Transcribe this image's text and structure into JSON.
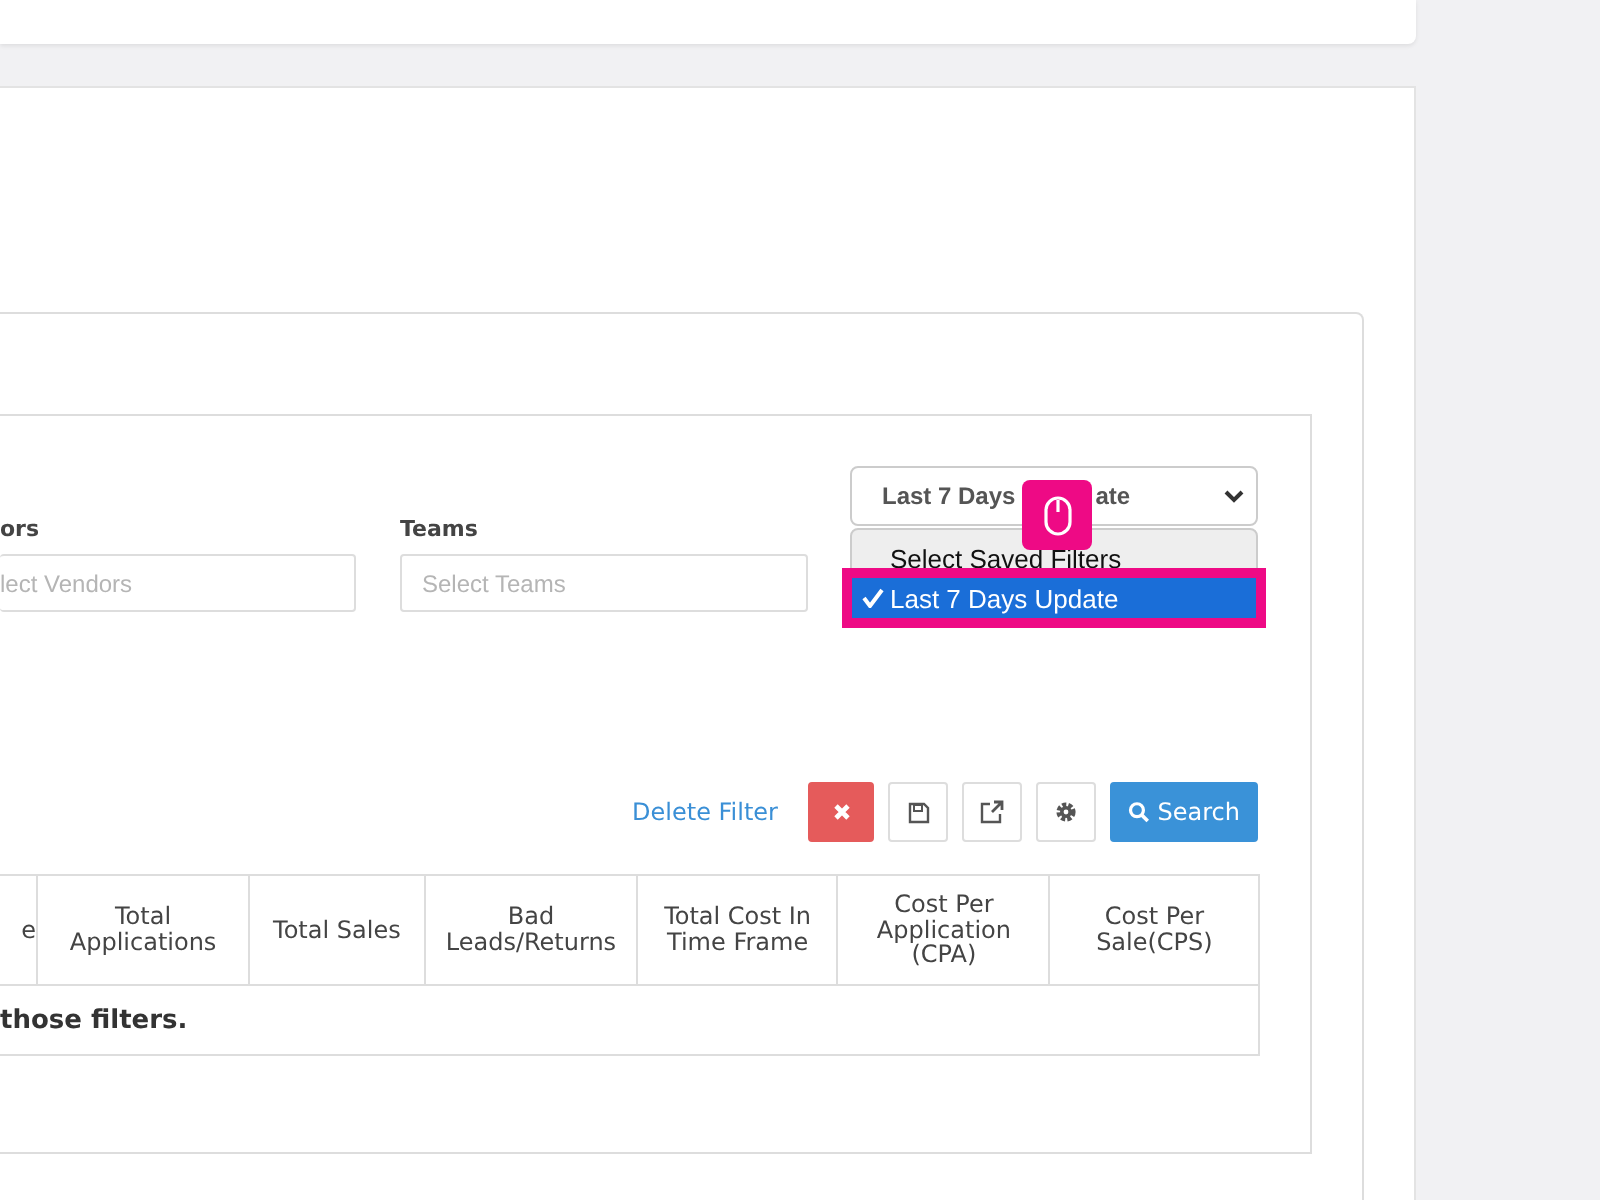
{
  "filters": [
    {
      "label": "ors",
      "placeholder": "lect Vendors"
    },
    {
      "label": "Teams",
      "placeholder": "Select Teams"
    }
  ],
  "saved_filter": {
    "value_visible_parts": [
      "Last 7 Days",
      "ate"
    ],
    "options": [
      {
        "label": "Select Saved Filters",
        "selected": false
      },
      {
        "label": "Last 7 Days Update",
        "selected": true
      }
    ]
  },
  "actions": {
    "delete_link": "Delete Filter",
    "buttons": [
      {
        "kind": "clear"
      },
      {
        "kind": "save"
      },
      {
        "kind": "export"
      },
      {
        "kind": "settings"
      },
      {
        "kind": "search",
        "label": "Search"
      }
    ]
  },
  "table": {
    "columns": [
      "e",
      "Total Applications",
      "Total Sales",
      "Bad Leads/Returns",
      "Total Cost In Time Frame",
      "Cost Per Application (CPA)",
      "Cost Per Sale(CPS)"
    ],
    "empty_message": "those filters."
  }
}
